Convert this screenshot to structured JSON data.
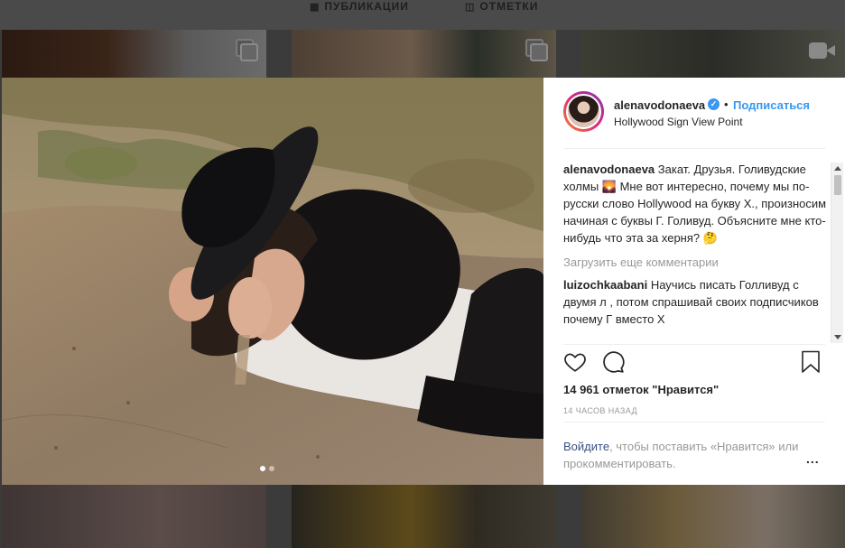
{
  "profile_tabs": [
    {
      "icon": "grid-icon",
      "label": "ПУБЛИКАЦИИ"
    },
    {
      "icon": "tagged-icon",
      "label": "ОТМЕТКИ"
    }
  ],
  "post": {
    "author": {
      "username": "alenavodonaeva",
      "verified": true,
      "follow_label": "Подписаться",
      "location": "Hollywood Sign View Point"
    },
    "caption": {
      "username": "alenavodonaeva",
      "text": "Закат. Друзья. Голивудские холмы 🌄 Мне вот интересно, почему мы по-русски слово Hollywood на букву Х., произносим начиная с буквы Г. Голивуд. Объясните мне кто-нибудь что эта за херня? 🤔"
    },
    "load_more_label": "Загрузить еще комментарии",
    "comments": [
      {
        "username": "luizochkaabani",
        "text": "Научись писать Голливуд с двумя л , потом спрашивай своих подписчиков почему Г вместо Х"
      }
    ],
    "likes_text": "14 961 отметок \"Нравится\"",
    "time_ago": "14 ЧАСОВ НАЗАД",
    "login_prompt": {
      "link": "Войдите",
      "text": ", чтобы поставить «Нравится» или прокомментировать."
    },
    "more_label": "...",
    "carousel_dots": 2
  },
  "colors": {
    "accent": "#3897f0",
    "link": "#385185",
    "muted": "#999999",
    "text": "#262626"
  }
}
